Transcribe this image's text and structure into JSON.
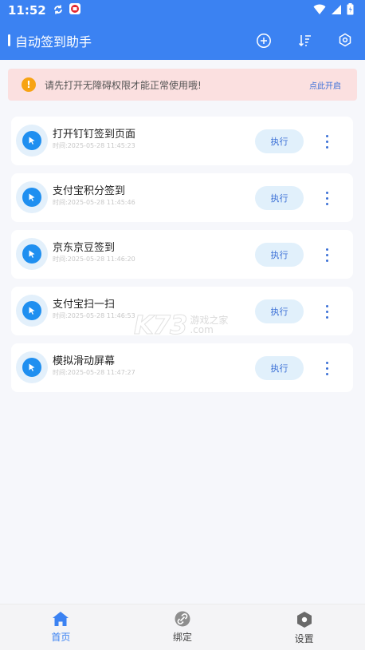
{
  "status_bar": {
    "time": "11:52"
  },
  "header": {
    "title": "自动签到助手"
  },
  "banner": {
    "icon_text": "!",
    "message": "请先打开无障碍权限才能正常使用哦!",
    "link": "点此开启"
  },
  "tasks": [
    {
      "name": "打开钉钉签到页面",
      "time": "时间:2025-05-28 11:45:23",
      "action": "执行"
    },
    {
      "name": "支付宝积分签到",
      "time": "时间:2025-05-28 11:45:46",
      "action": "执行"
    },
    {
      "name": "京东京豆签到",
      "time": "时间:2025-05-28 11:46:20",
      "action": "执行"
    },
    {
      "name": "支付宝扫一扫",
      "time": "时间:2025-05-28 11:46:53",
      "action": "执行"
    },
    {
      "name": "模拟滑动屏幕",
      "time": "时间:2025-05-28 11:47:27",
      "action": "执行"
    }
  ],
  "watermark": {
    "logo": "K73",
    "line1": "游戏之家",
    "line2": ".com"
  },
  "bottom_nav": [
    {
      "label": "首页",
      "icon": "home-icon",
      "active": true
    },
    {
      "label": "绑定",
      "icon": "link-icon",
      "active": false
    },
    {
      "label": "设置",
      "icon": "settings-icon",
      "active": false
    }
  ],
  "colors": {
    "primary": "#3b82f2",
    "banner_bg": "#fbe0e0",
    "warning": "#f7a313",
    "task_icon": "#1f8ff0"
  }
}
